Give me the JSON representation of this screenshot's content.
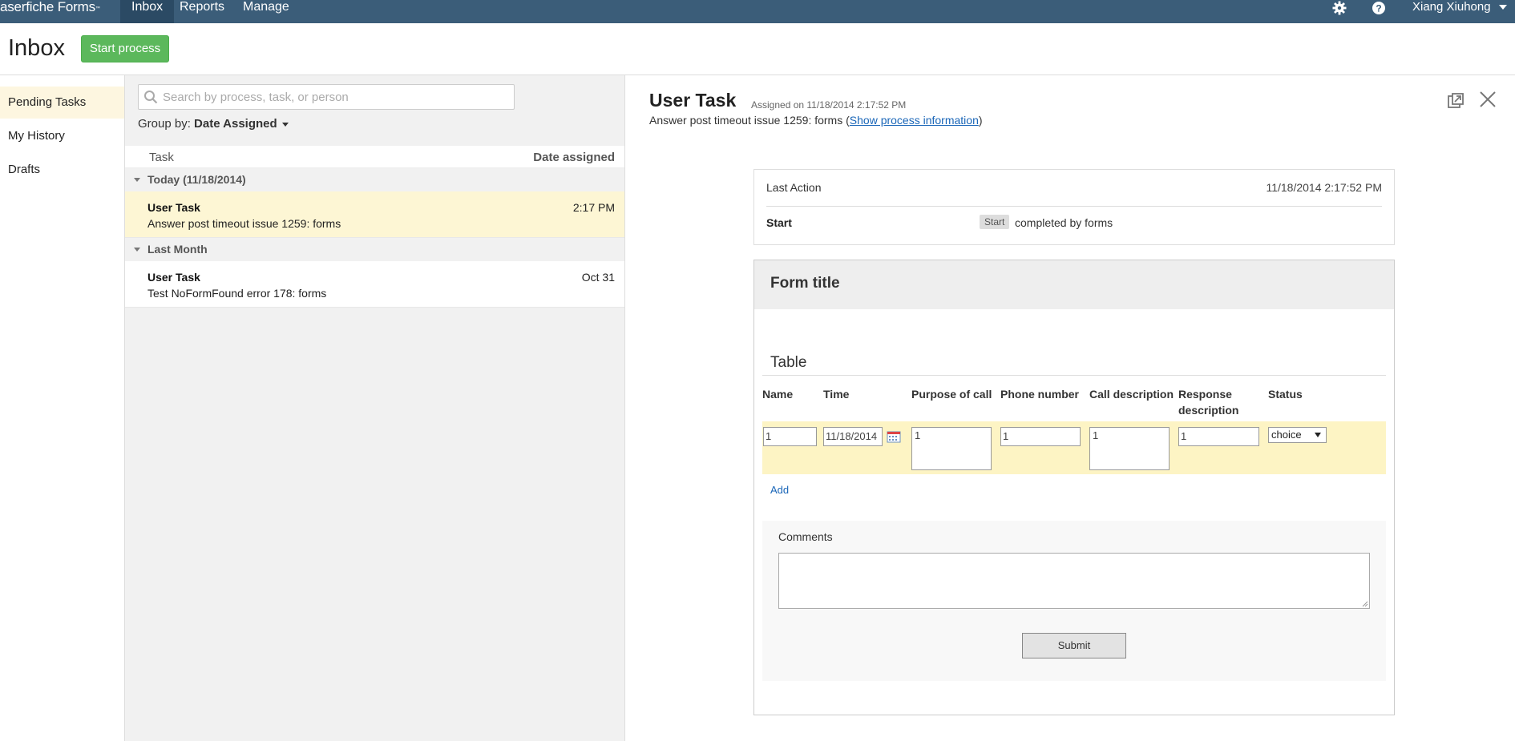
{
  "topbar": {
    "brand": "aserfiche Forms",
    "brand_mark": "™",
    "nav": [
      {
        "label": "Inbox",
        "active": true
      },
      {
        "label": "Reports",
        "active": false
      },
      {
        "label": "Manage",
        "active": false
      }
    ],
    "user": "Xiang Xiuhong",
    "icons": [
      "gear-icon",
      "help-icon"
    ],
    "bar_color": "#3b5d79"
  },
  "header": {
    "title": "Inbox",
    "start_button": "Start process",
    "start_color": "#5cb85c"
  },
  "sidebar": {
    "items": [
      {
        "label": "Pending Tasks",
        "active": true
      },
      {
        "label": "My History",
        "active": false
      },
      {
        "label": "Drafts",
        "active": false
      }
    ]
  },
  "list": {
    "search_placeholder": "Search by process, task, or person",
    "group_by_label": "Group by:",
    "group_by_value": "Date Assigned",
    "columns": {
      "task": "Task",
      "date": "Date assigned"
    },
    "groups": [
      {
        "label": "Today (11/18/2014)",
        "rows": [
          {
            "task": "User Task",
            "desc": "Answer post timeout issue 1259: forms",
            "date": "2:17 PM",
            "selected": true
          }
        ]
      },
      {
        "label": "Last Month",
        "rows": [
          {
            "task": "User Task",
            "desc": "Test NoFormFound error 178: forms",
            "date": "Oct 31",
            "selected": false
          }
        ]
      }
    ]
  },
  "detail": {
    "title": "User Task",
    "assigned": "Assigned on 11/18/2014 2:17:52 PM",
    "subtitle_prefix": "Answer post timeout issue 1259: forms (",
    "subtitle_link": "Show process information",
    "subtitle_suffix": ")",
    "last_action": {
      "label": "Last Action",
      "date": "11/18/2014 2:17:52 PM",
      "step": "Start",
      "badge": "Start",
      "by": "completed by forms"
    },
    "form": {
      "title": "Form title",
      "section": "Table",
      "columns": [
        "Name",
        "Time",
        "Purpose of call",
        "Phone number",
        "Call description",
        "Response description",
        "Status"
      ],
      "row": {
        "name": "1",
        "time": "11/18/2014",
        "purpose": "1",
        "phone": "1",
        "call_description": "1",
        "response_description": "1",
        "status": "choice"
      },
      "add_label": "Add",
      "comments_label": "Comments",
      "comments_value": "",
      "submit_label": "Submit"
    }
  }
}
